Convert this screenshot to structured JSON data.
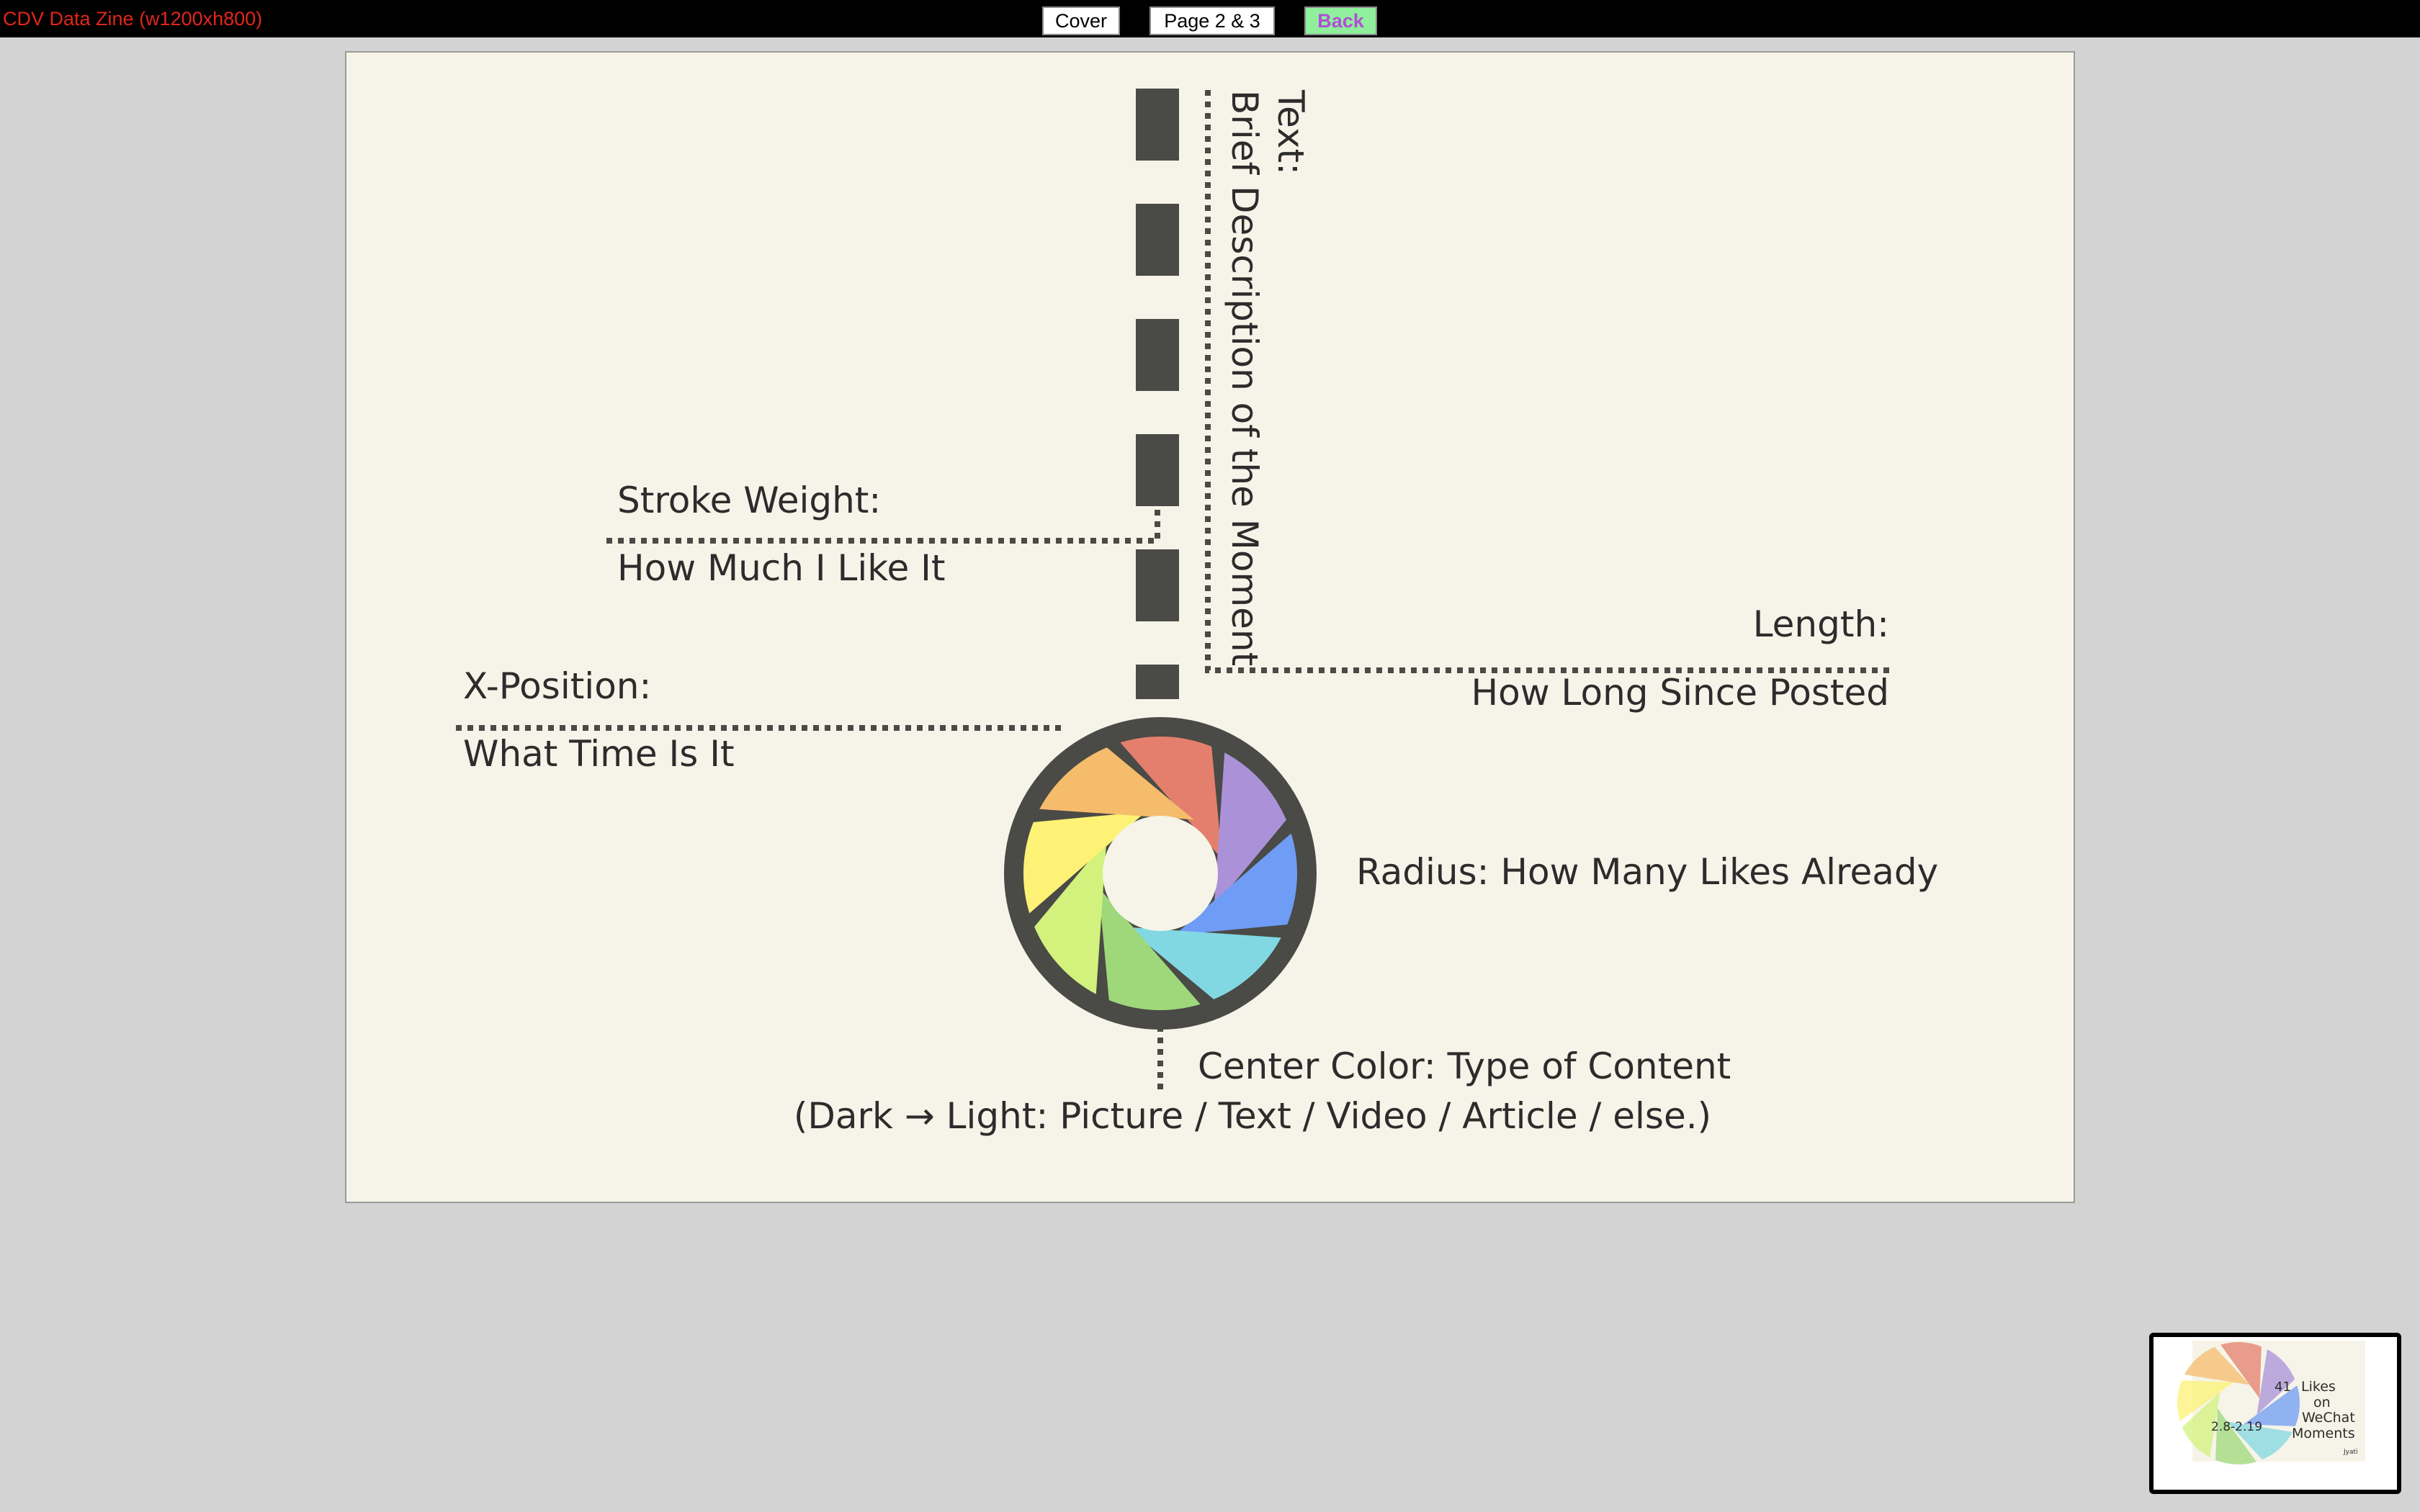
{
  "app": {
    "title": "CDV Data Zine (w1200xh800)"
  },
  "nav": {
    "cover_label": "Cover",
    "page_label": "Page 2 & 3",
    "back_label": "Back"
  },
  "colors": {
    "canvas_bg": "#f6f4e8",
    "ink": "#4a4a46",
    "text": "#2c2c2c",
    "title_red": "#e0261b",
    "back_bg": "#8fef9c",
    "back_text": "#b04fd6",
    "petals": [
      "#e57f6d",
      "#ab92d8",
      "#6f9cf5",
      "#82d8e2",
      "#9ed87a",
      "#d2f27d",
      "#fdf275",
      "#f5bc6c"
    ]
  },
  "legend": {
    "text_title": "Text:",
    "text_desc": "Brief Description of the Moment",
    "stroke_title": "Stroke Weight:",
    "stroke_desc": "How Much I Like It",
    "length_title": "Length:",
    "length_desc": "How Long Since Posted",
    "xpos_title": "X-Position:",
    "xpos_desc": "What Time Is It",
    "radius": "Radius: How Many Likes Already",
    "center_color_title": "Center Color: Type of Content",
    "center_color_desc": "(Dark → Light: Picture / Text / Video / Article / else.)"
  },
  "minimap": {
    "count": "41",
    "caption_lines": [
      "Likes",
      "on",
      "WeChat",
      "Moments"
    ],
    "date_range": "2.8-2.19",
    "author": "Jyati"
  }
}
